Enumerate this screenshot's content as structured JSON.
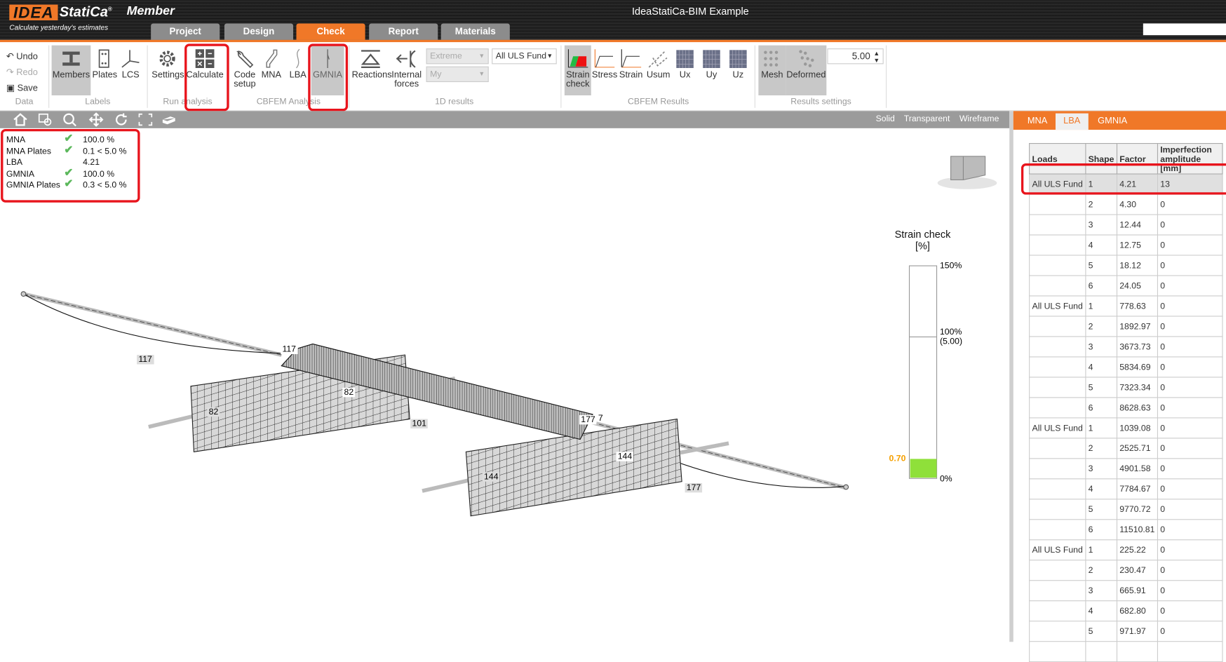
{
  "app": {
    "logo": "IDEA StatiCa",
    "product": "Member",
    "tagline": "Calculate yesterday's estimates",
    "title": "IdeaStatiCa-BIM Example"
  },
  "main_tabs": [
    {
      "label": "Project"
    },
    {
      "label": "Design"
    },
    {
      "label": "Check",
      "active": true
    },
    {
      "label": "Report"
    },
    {
      "label": "Materials"
    }
  ],
  "ribbon": {
    "data": {
      "undo": "Undo",
      "redo": "Redo",
      "save": "Save",
      "group": "Data"
    },
    "labels": {
      "members": "Members",
      "plates": "Plates",
      "lcs": "LCS",
      "group": "Labels"
    },
    "run": {
      "settings": "Settings",
      "calculate": "Calculate",
      "group": "Run analysis"
    },
    "cbfem": {
      "code_setup_1": "Code",
      "code_setup_2": "setup",
      "mna": "MNA",
      "lba": "LBA",
      "gmnia": "GMNIA",
      "group": "CBFEM Analysis"
    },
    "results1d": {
      "reactions": "Reactions",
      "internal_1": "Internal",
      "internal_2": "forces",
      "extreme": "Extreme",
      "my": "My",
      "load": "All ULS Fund",
      "group": "1D results"
    },
    "cbfem_results": {
      "strain_check_1": "Strain",
      "strain_check_2": "check",
      "stress": "Stress",
      "strain": "Strain",
      "usum": "Usum",
      "ux": "Ux",
      "uy": "Uy",
      "uz": "Uz",
      "group": "CBFEM Results"
    },
    "settings": {
      "mesh": "Mesh",
      "deformed": "Deformed",
      "scale": "5.00",
      "group": "Results settings"
    }
  },
  "view_modes": {
    "solid": "Solid",
    "transparent": "Transparent",
    "wireframe": "Wireframe"
  },
  "status": [
    {
      "label": "MNA",
      "ok": true,
      "value": "100.0 %"
    },
    {
      "label": "MNA Plates",
      "ok": true,
      "value": "0.1 < 5.0 %"
    },
    {
      "label": "LBA",
      "ok": false,
      "value": "4.21"
    },
    {
      "label": "GMNIA",
      "ok": true,
      "value": "100.0 %"
    },
    {
      "label": "GMNIA Plates",
      "ok": true,
      "value": "0.3 < 5.0 %"
    }
  ],
  "model_labels": [
    "117",
    "117",
    "82",
    "82",
    "101",
    "177",
    "7",
    "144",
    "144",
    "177"
  ],
  "legend": {
    "title": "Strain check",
    "unit": "[%]",
    "max": "150%",
    "limit": "100%",
    "limit_value": "(5.00)",
    "min": "0%",
    "current": "0.70",
    "current_fraction_of_max": 0.0047,
    "fill_color": "#8fe03a",
    "current_color": "#f5a000"
  },
  "right_tabs": [
    {
      "label": "MNA"
    },
    {
      "label": "LBA",
      "active": true
    },
    {
      "label": "GMNIA"
    }
  ],
  "table": {
    "headers": [
      "Loads",
      "Shape",
      "Factor",
      "Imperfection amplitude [mm]"
    ],
    "rows": [
      [
        "All ULS Fund",
        "1",
        "4.21",
        "13"
      ],
      [
        "",
        "2",
        "4.30",
        "0"
      ],
      [
        "",
        "3",
        "12.44",
        "0"
      ],
      [
        "",
        "4",
        "12.75",
        "0"
      ],
      [
        "",
        "5",
        "18.12",
        "0"
      ],
      [
        "",
        "6",
        "24.05",
        "0"
      ],
      [
        "All ULS Fund",
        "1",
        "778.63",
        "0"
      ],
      [
        "",
        "2",
        "1892.97",
        "0"
      ],
      [
        "",
        "3",
        "3673.73",
        "0"
      ],
      [
        "",
        "4",
        "5834.69",
        "0"
      ],
      [
        "",
        "5",
        "7323.34",
        "0"
      ],
      [
        "",
        "6",
        "8628.63",
        "0"
      ],
      [
        "All ULS Fund",
        "1",
        "1039.08",
        "0"
      ],
      [
        "",
        "2",
        "2525.71",
        "0"
      ],
      [
        "",
        "3",
        "4901.58",
        "0"
      ],
      [
        "",
        "4",
        "7784.67",
        "0"
      ],
      [
        "",
        "5",
        "9770.72",
        "0"
      ],
      [
        "",
        "6",
        "11510.81",
        "0"
      ],
      [
        "All ULS Fund",
        "1",
        "225.22",
        "0"
      ],
      [
        "",
        "2",
        "230.47",
        "0"
      ],
      [
        "",
        "3",
        "665.91",
        "0"
      ],
      [
        "",
        "4",
        "682.80",
        "0"
      ],
      [
        "",
        "5",
        "971.97",
        "0"
      ],
      [
        "",
        "",
        "",
        ""
      ]
    ]
  },
  "colors": {
    "accent": "#f07828",
    "highlight": "#e8141c"
  }
}
